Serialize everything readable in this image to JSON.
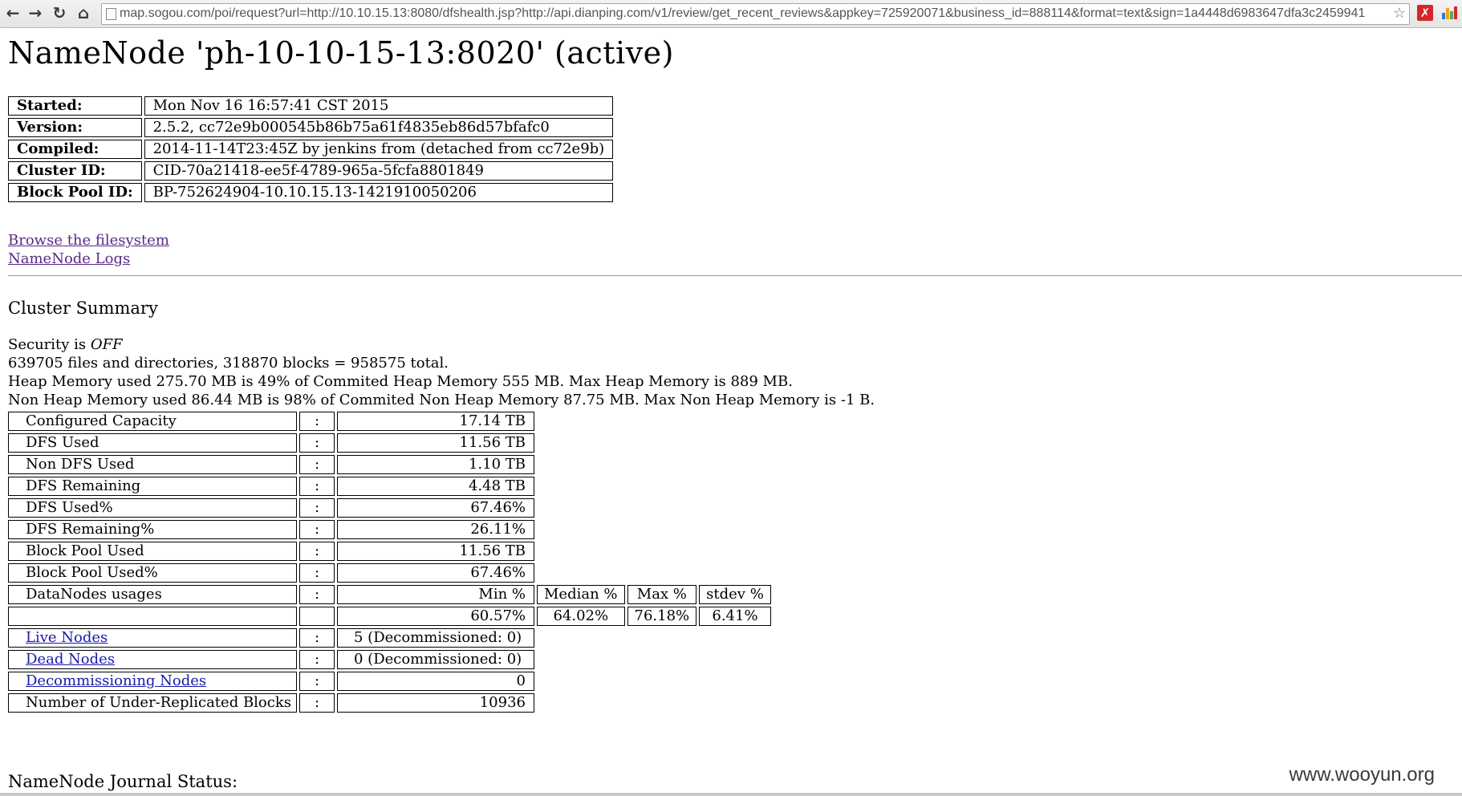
{
  "browser": {
    "url": "map.sogou.com/poi/request?url=http://10.10.15.13:8080/dfshealth.jsp?http://api.dianping.com/v1/review/get_recent_reviews&appkey=725920071&business_id=888114&format=text&sign=1a4448d6983647dfa3c2459941",
    "icons": [
      "back-icon",
      "forward-icon",
      "reload-icon",
      "home-icon",
      "page-icon",
      "star-icon",
      "extension-icon",
      "chart-extension-icon"
    ],
    "colors": {
      "ext_red": "#d6262c"
    }
  },
  "page": {
    "title": "NameNode 'ph-10-10-15-13:8020' (active)",
    "info": [
      {
        "key": "Started:",
        "value": "Mon Nov 16 16:57:41 CST 2015"
      },
      {
        "key": "Version:",
        "value": "2.5.2, cc72e9b000545b86b75a61f4835eb86d57bfafc0"
      },
      {
        "key": "Compiled:",
        "value": "2014-11-14T23:45Z by jenkins from (detached from cc72e9b)"
      },
      {
        "key": "Cluster ID:",
        "value": "CID-70a21418-ee5f-4789-965a-5fcfa8801849"
      },
      {
        "key": "Block Pool ID:",
        "value": "BP-752624904-10.10.15.13-1421910050206"
      }
    ],
    "links": {
      "browse": "Browse the filesystem",
      "logs": "NameNode Logs"
    },
    "cluster_summary": {
      "title": "Cluster Summary",
      "security_prefix": "Security is ",
      "security_value": "OFF",
      "files_line": "639705 files and directories, 318870 blocks = 958575 total.",
      "heap_line": "Heap Memory used 275.70 MB is 49% of Commited Heap Memory 555 MB. Max Heap Memory is 889 MB.",
      "nonheap_line": "Non Heap Memory used 86.44 MB is 98% of Commited Non Heap Memory 87.75 MB. Max Non Heap Memory is -1 B."
    },
    "colon": ":",
    "stats": [
      {
        "label": "Configured Capacity",
        "value": "17.14 TB"
      },
      {
        "label": "DFS Used",
        "value": "11.56 TB"
      },
      {
        "label": "Non DFS Used",
        "value": "1.10 TB"
      },
      {
        "label": "DFS Remaining",
        "value": "4.48 TB"
      },
      {
        "label": "DFS Used%",
        "value": "67.46%"
      },
      {
        "label": "DFS Remaining%",
        "value": "26.11%"
      },
      {
        "label": "Block Pool Used",
        "value": "11.56 TB"
      },
      {
        "label": "Block Pool Used%",
        "value": "67.46%"
      }
    ],
    "datanodes": {
      "label": "DataNodes usages",
      "headers": [
        "Min %",
        "Median %",
        "Max %",
        "stdev %"
      ],
      "values": [
        "60.57%",
        "64.02%",
        "76.18%",
        "6.41%"
      ]
    },
    "nodes": [
      {
        "label": "Live Nodes",
        "value": "5 (Decommissioned: 0)"
      },
      {
        "label": "Dead Nodes",
        "value": "0 (Decommissioned: 0)"
      },
      {
        "label": "Decommissioning Nodes",
        "value": "0"
      }
    ],
    "under_replicated": {
      "label": "Number of Under-Replicated Blocks",
      "value": "10936"
    },
    "journal_title": "NameNode Journal Status:"
  },
  "watermark": "www.wooyun.org"
}
